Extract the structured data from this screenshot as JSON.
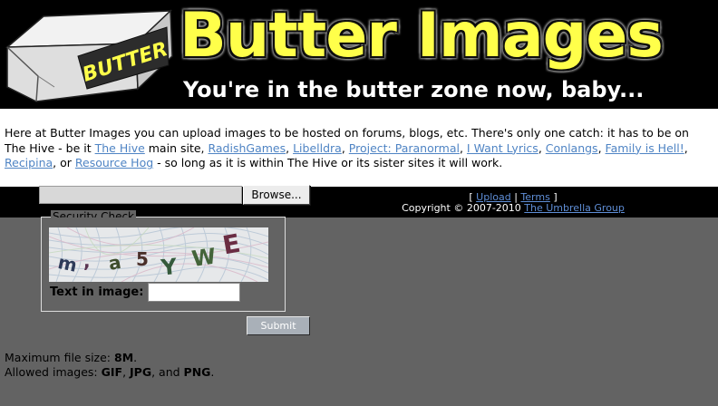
{
  "header": {
    "logo_text": "BUTTER",
    "title": "Butter Images",
    "tagline": "You're in the butter zone now, baby..."
  },
  "intro": {
    "text_1": "Here at Butter Images you can upload images to be hosted on forums, blogs, etc. There's only one catch: it has to be on The Hive - be it ",
    "text_2": " main site, ",
    "text_3": ", or ",
    "text_4": " - so long as it is within The Hive or its sister sites it will work.",
    "sep": ", ",
    "links": [
      "The Hive",
      "RadishGames",
      "Libelldra",
      "Project: Paranormal",
      "I Want Lyrics",
      "Conlangs",
      "Family is Hell!",
      "Recipina",
      "Resource Hog"
    ]
  },
  "upload": {
    "browse_label": "Browse..."
  },
  "footer": {
    "bracket_open": "[ ",
    "upload_link": "Upload",
    "pipe": " | ",
    "terms_link": "Terms",
    "bracket_close": " ]",
    "copyright_prefix": "Copyright © 2007-2010 ",
    "company_link": "The Umbrella Group"
  },
  "security": {
    "legend": "Security Check",
    "captcha_chars": [
      "m",
      ",",
      "a",
      "5",
      "Y",
      "W",
      "E"
    ],
    "text_label": "Text in image:",
    "input_value": ""
  },
  "submit_label": "Submit",
  "limits": {
    "size_prefix": "Maximum file size: ",
    "size_value": "8M",
    "size_suffix": ".",
    "types_prefix": "Allowed images: ",
    "type_1": "GIF",
    "sep_1": ", ",
    "type_2": "JPG",
    "sep_2": ", and ",
    "type_3": "PNG",
    "types_suffix": "."
  }
}
